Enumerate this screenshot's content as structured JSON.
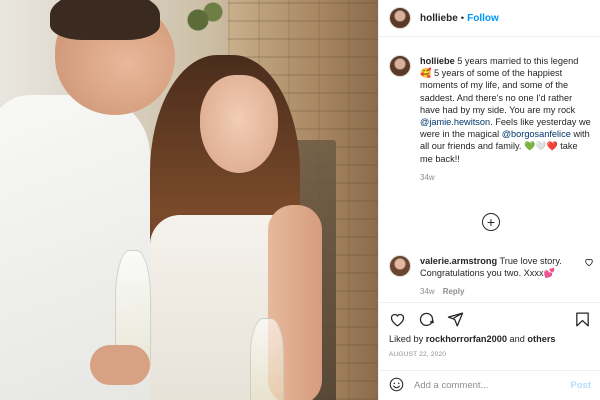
{
  "post": {
    "author": "holliebe",
    "follow_label": "Follow",
    "separator": "•"
  },
  "caption": {
    "username": "holliebe",
    "text_part1": " 5 years married to this legend ",
    "emoji1": "🥰",
    "text_part2": " 5 years of some of the happiest moments of my life, and some of the saddest. And there's no one I'd rather have had by my side. You are my rock ",
    "mention1": "@jamie.hewitson",
    "text_part3": ". Feels like yesterday we were in the magical ",
    "mention2": "@borgosanfelice",
    "text_part4": " with all our friends and family. ",
    "hearts": [
      "💚",
      "🤍",
      "❤️"
    ],
    "text_part5": " take me back!!",
    "time": "34w"
  },
  "load_more_icon": "plus-circle-icon",
  "comment": {
    "username": "valerie.armstrong",
    "text": " True love story. Congratulations you two. Xxxx",
    "emoji": "💕",
    "time": "34w",
    "reply_label": "Reply",
    "like_icon": "heart-outline-icon"
  },
  "actions": {
    "icons": [
      "heart-outline-icon",
      "comment-icon",
      "share-icon",
      "bookmark-icon"
    ]
  },
  "likes": {
    "prefix": "Liked by ",
    "user": "rockhorrorfan2000",
    "middle": " and ",
    "others": "others"
  },
  "date": "AUGUST 22, 2020",
  "add_comment": {
    "placeholder": "Add a comment...",
    "post_label": "Post",
    "emoji_icon": "smiley-icon"
  },
  "colors": {
    "accent": "#0095f6",
    "mention": "#00376b",
    "muted": "#8e8e8e",
    "post_disabled": "#b2dffc"
  }
}
